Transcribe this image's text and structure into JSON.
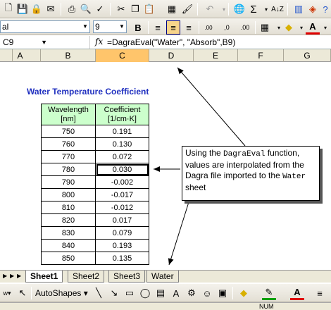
{
  "toolbar": {
    "font_name": "al",
    "font_size": "9",
    "sum_symbol": "Σ"
  },
  "formula_bar": {
    "cell_ref": "C9",
    "fx": "fx",
    "formula": "=DagraEval(\"Water\", \"Absorb\",B9)"
  },
  "columns": [
    "A",
    "B",
    "C",
    "D",
    "E",
    "F",
    "G"
  ],
  "selected_column": "C",
  "sheet": {
    "title": "Water Temperature Coefficient",
    "headers": [
      {
        "line1": "Wavelength",
        "line2": "[nm]"
      },
      {
        "line1": "Coefficient",
        "line2": "[1/cm·K]"
      }
    ],
    "rows": [
      [
        "750",
        "0.191"
      ],
      [
        "760",
        "0.130"
      ],
      [
        "770",
        "0.072"
      ],
      [
        "780",
        "0.030"
      ],
      [
        "790",
        "-0.002"
      ],
      [
        "800",
        "-0.017"
      ],
      [
        "810",
        "-0.012"
      ],
      [
        "820",
        "0.017"
      ],
      [
        "830",
        "0.079"
      ],
      [
        "840",
        "0.193"
      ],
      [
        "850",
        "0.135"
      ]
    ]
  },
  "callout": {
    "t1": "Using the ",
    "t2": "DagraEval",
    "t3": " function, values are interpolated from the Dagra file imported to the ",
    "t4": "Water",
    "t5": " sheet"
  },
  "tabs": [
    "Sheet1",
    "Sheet2",
    "Sheet3",
    "Water"
  ],
  "active_tab": "Sheet1",
  "draw_toolbar": {
    "autoshapes": "AutoShapes"
  },
  "status": {
    "num": "NUM"
  },
  "colors": {
    "title": "#1f2fbf",
    "header_fill": "#ccffcc",
    "selected_col": "#ffc56b"
  }
}
